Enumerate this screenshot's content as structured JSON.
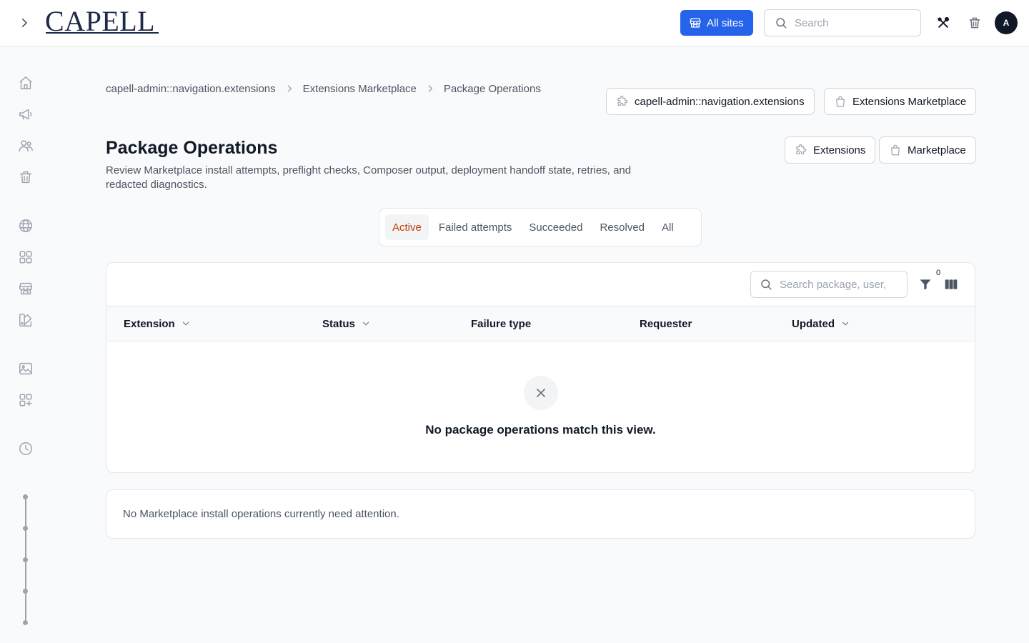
{
  "app": {
    "logo_text": "CAPELL"
  },
  "header": {
    "all_sites_label": "All sites",
    "search_placeholder": "Search",
    "avatar_initial": "A"
  },
  "breadcrumb": [
    {
      "label": "capell-admin::navigation.extensions"
    },
    {
      "label": "Extensions Marketplace"
    },
    {
      "label": "Package Operations"
    }
  ],
  "header_actions": {
    "navigation_extensions_label": "capell-admin::navigation.extensions",
    "extensions_marketplace_label": "Extensions Marketplace",
    "extensions_label": "Extensions",
    "marketplace_label": "Marketplace"
  },
  "page": {
    "title": "Package Operations",
    "description": "Review Marketplace install attempts, preflight checks, Composer output, deployment handoff state, retries, and redacted diagnostics."
  },
  "tabs": [
    {
      "label": "Active",
      "active": true
    },
    {
      "label": "Failed attempts",
      "active": false
    },
    {
      "label": "Succeeded",
      "active": false
    },
    {
      "label": "Resolved",
      "active": false
    },
    {
      "label": "All",
      "active": false
    }
  ],
  "table": {
    "search_placeholder": "Search package, user,",
    "filter_count": "0",
    "columns": [
      {
        "label": "Extension",
        "sortable": true
      },
      {
        "label": "Status",
        "sortable": true
      },
      {
        "label": "Failure type",
        "sortable": false
      },
      {
        "label": "Requester",
        "sortable": false
      },
      {
        "label": "Updated",
        "sortable": true
      }
    ],
    "empty_message": "No package operations match this view."
  },
  "notice": {
    "text": "No Marketplace install operations currently need attention."
  },
  "colors": {
    "primary": "#2563eb",
    "active_tab_text": "#c2410c",
    "brand": "#1e2a4a"
  },
  "icons": {
    "sidebar": [
      "home-icon",
      "megaphone-icon",
      "users-icon",
      "trash-icon",
      "globe-icon",
      "grid-icon",
      "storefront-icon",
      "swatch-icon",
      "image-icon",
      "grid-plus-icon",
      "clock-icon"
    ]
  }
}
